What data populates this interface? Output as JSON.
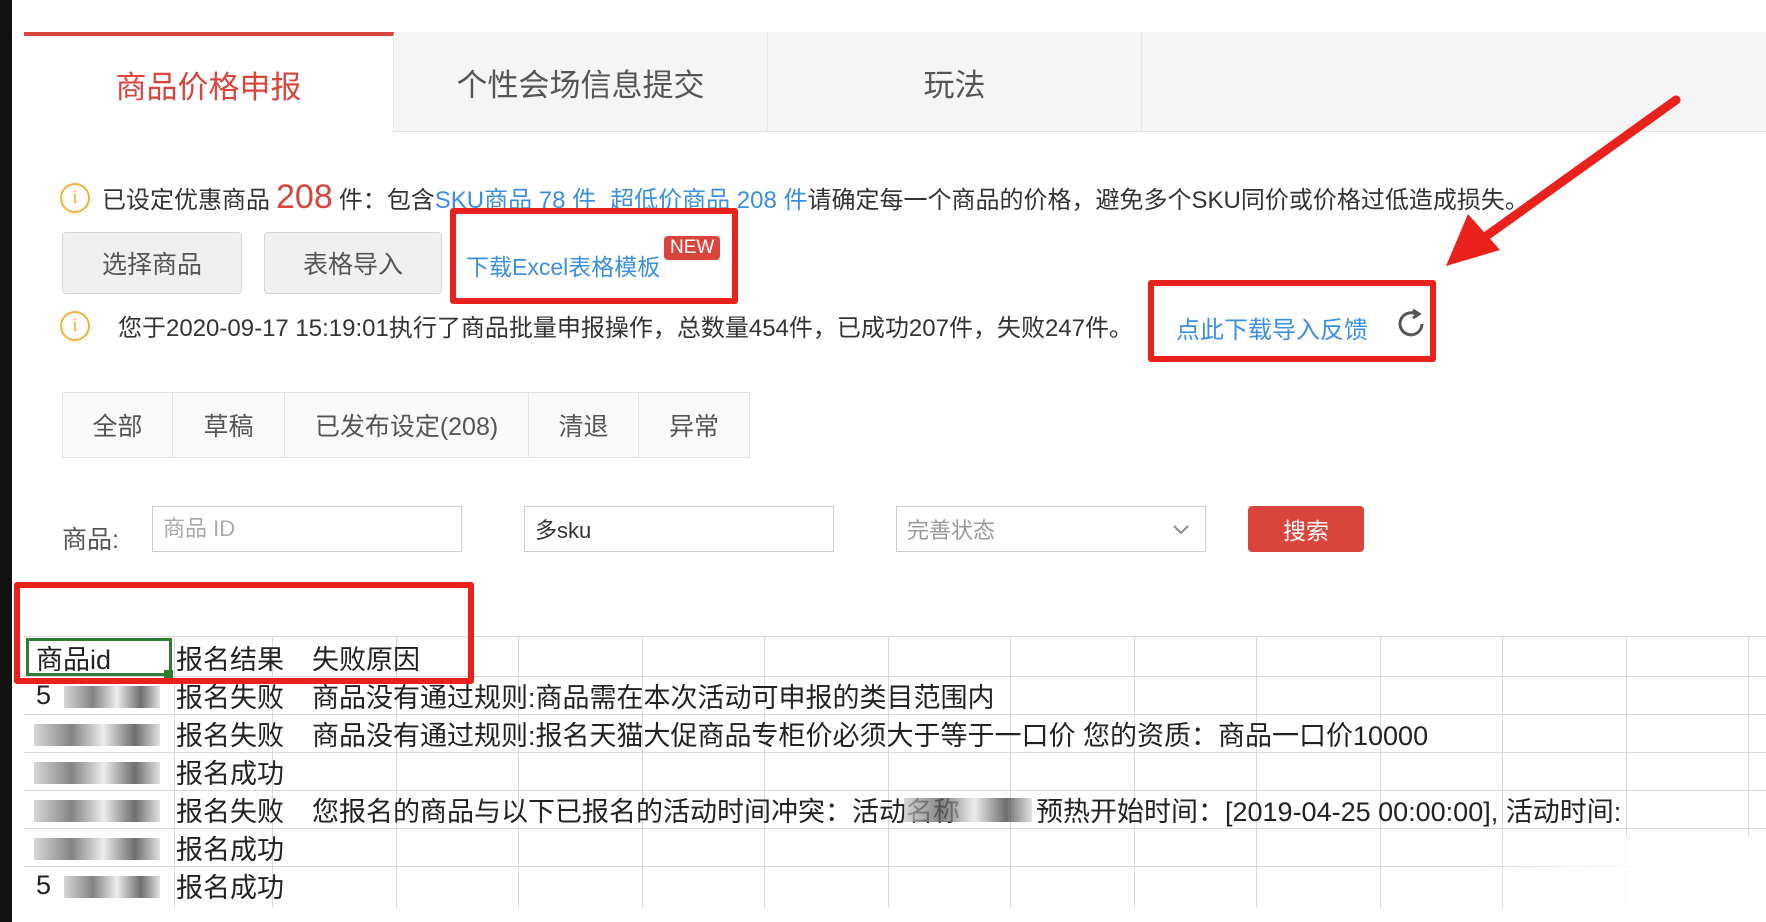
{
  "tabs": [
    {
      "label": "商品价格申报",
      "active": true
    },
    {
      "label": "个性会场信息提交",
      "active": false
    },
    {
      "label": "玩法",
      "active": false
    }
  ],
  "info1": {
    "prefix": "已设定优惠商品",
    "count": "208",
    "unit_text": "件：包含",
    "sku_link": "SKU商品 78 件",
    "low_price_link": "超低价商品 208 件",
    "suffix": "请确定每一个商品的价格，避免多个SKU同价或价格过低造成损失。"
  },
  "actions": {
    "select_goods": "选择商品",
    "table_import": "表格导入",
    "download_template": "下载Excel表格模板",
    "new_badge": "NEW"
  },
  "info2": {
    "message": "您于2020-09-17 15:19:01执行了商品批量申报操作，总数量454件，已成功207件，失败247件。",
    "feedback_link": "点此下载导入反馈"
  },
  "status_tabs": [
    "全部",
    "草稿",
    "已发布设定(208)",
    "清退",
    "异常"
  ],
  "search": {
    "label": "商品:",
    "id_placeholder": "商品 ID",
    "sku_value": "多sku",
    "status_placeholder": "完善状态",
    "button": "搜索"
  },
  "sheet": {
    "headers": [
      "商品id",
      "报名结果",
      "失败原因"
    ],
    "rows": [
      {
        "id": "5",
        "result": "报名失败",
        "reason": "商品没有通过规则:商品需在本次活动可申报的类目范围内"
      },
      {
        "id": "",
        "result": "报名失败",
        "reason": "商品没有通过规则:报名天猫大促商品专柜价必须大于等于一口价 您的资质：商品一口价10000"
      },
      {
        "id": "",
        "result": "报名成功",
        "reason": ""
      },
      {
        "id": "",
        "result": "报名失败",
        "reason": "您报名的商品与以下已报名的活动时间冲突：活动名称"
      },
      {
        "id": "",
        "result": "报名成功",
        "reason": ""
      },
      {
        "id": "5",
        "result": "报名成功",
        "reason": ""
      }
    ],
    "row3_tail": "预热开始时间：[2019-04-25 00:00:00], 活动时间:"
  },
  "colors": {
    "accent": "#d9453d",
    "link": "#3b8fe0",
    "warning": "#f0b43c",
    "annotation": "#e8211d"
  }
}
